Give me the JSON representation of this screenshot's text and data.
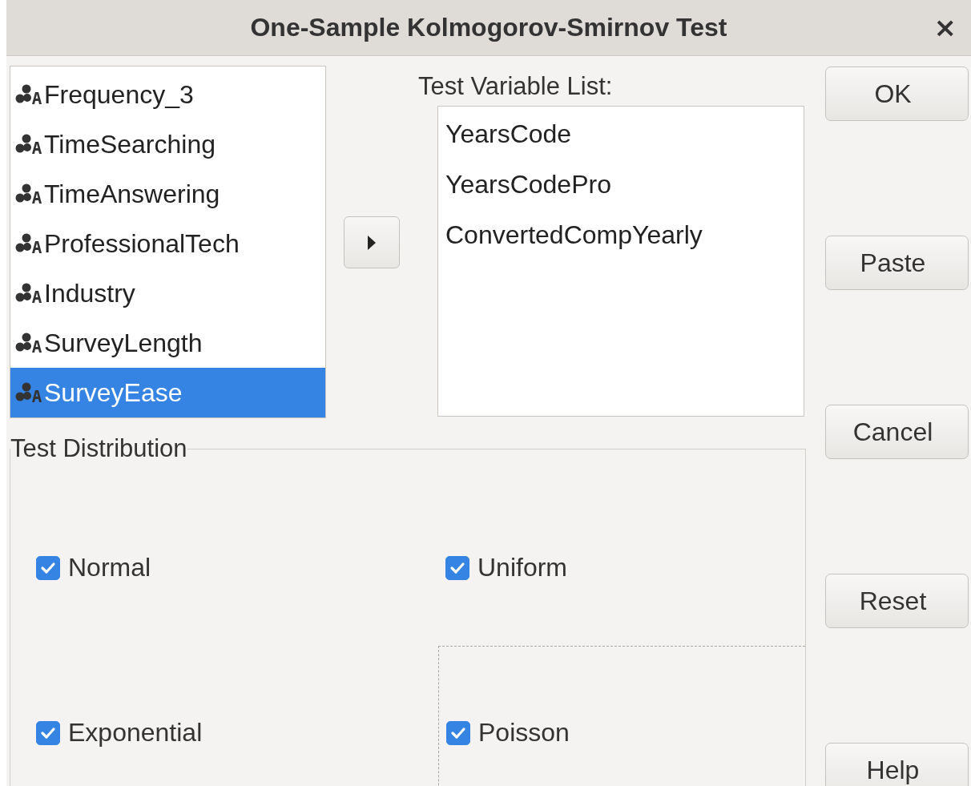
{
  "window": {
    "title": "One-Sample Kolmogorov-Smirnov Test",
    "close": "×"
  },
  "source_list": {
    "items": [
      {
        "label": "Frequency_3",
        "selected": false
      },
      {
        "label": "TimeSearching",
        "selected": false
      },
      {
        "label": "TimeAnswering",
        "selected": false
      },
      {
        "label": "ProfessionalTech",
        "selected": false
      },
      {
        "label": "Industry",
        "selected": false
      },
      {
        "label": "SurveyLength",
        "selected": false
      },
      {
        "label": "SurveyEase",
        "selected": true
      }
    ]
  },
  "target_list": {
    "label": "Test Variable List:",
    "items": [
      "YearsCode",
      "YearsCodePro",
      "ConvertedCompYearly"
    ]
  },
  "test_distribution": {
    "title": "Test Distribution",
    "options": [
      {
        "label": "Normal",
        "checked": true,
        "focused": false
      },
      {
        "label": "Uniform",
        "checked": true,
        "focused": false
      },
      {
        "label": "Exponential",
        "checked": true,
        "focused": false
      },
      {
        "label": "Poisson",
        "checked": true,
        "focused": true
      }
    ]
  },
  "buttons": [
    "OK",
    "Paste",
    "Cancel",
    "Reset",
    "Help"
  ]
}
